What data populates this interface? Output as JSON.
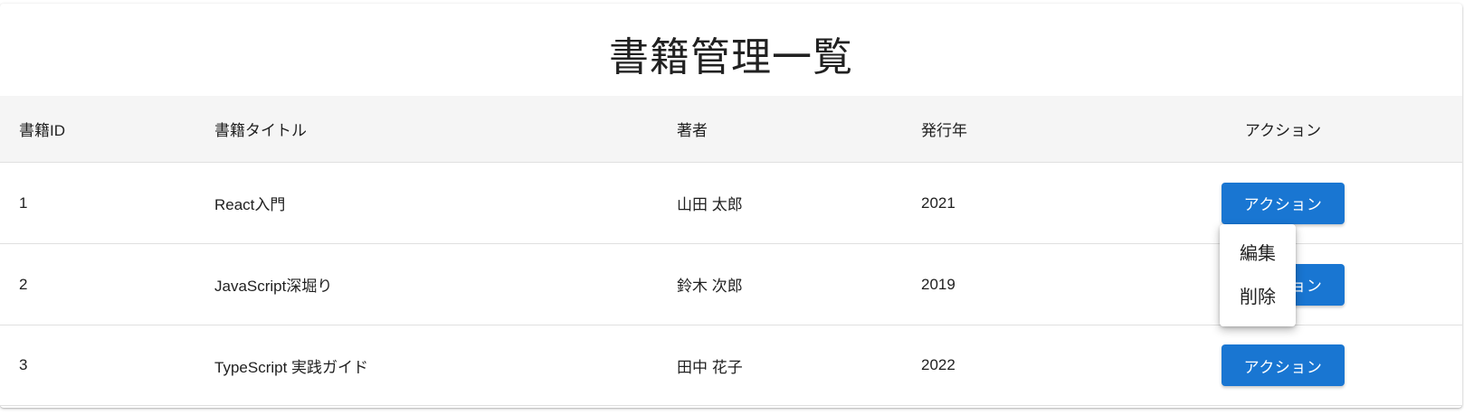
{
  "page": {
    "title": "書籍管理一覧"
  },
  "table": {
    "headers": {
      "id": "書籍ID",
      "title": "書籍タイトル",
      "author": "著者",
      "year": "発行年",
      "action": "アクション"
    },
    "rows": [
      {
        "id": "1",
        "title": "React入門",
        "author": "山田 太郎",
        "year": "2021",
        "action_label": "アクション"
      },
      {
        "id": "2",
        "title": "JavaScript深堀り",
        "author": "鈴木 次郎",
        "year": "2019",
        "action_label": "アクション"
      },
      {
        "id": "3",
        "title": "TypeScript 実践ガイド",
        "author": "田中 花子",
        "year": "2022",
        "action_label": "アクション"
      }
    ]
  },
  "action_menu": {
    "open_for_row": "1",
    "items": [
      {
        "label": "編集"
      },
      {
        "label": "削除"
      }
    ]
  },
  "colors": {
    "primary": "#1976d2",
    "header_bg": "#f5f5f5",
    "divider": "#e0e0e0",
    "text": "#212121"
  }
}
